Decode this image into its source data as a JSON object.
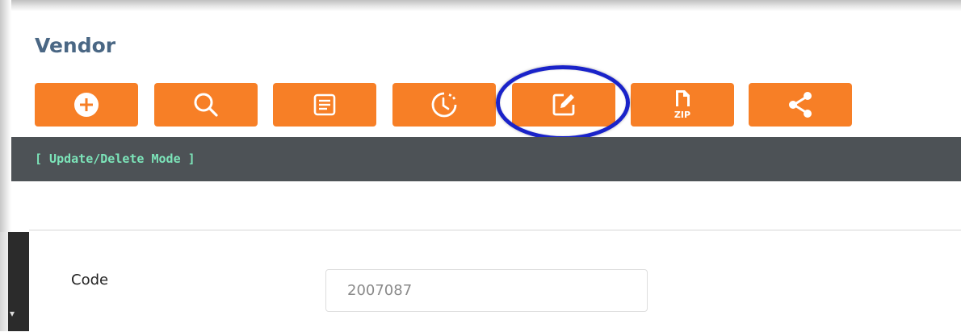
{
  "page": {
    "title": "Vendor",
    "mode_label": "[ Update/Delete Mode ]"
  },
  "toolbar": {
    "accent_color": "#f77f26",
    "highlight_color": "#1a23c9",
    "buttons": [
      {
        "icon": "add-icon"
      },
      {
        "icon": "search-icon"
      },
      {
        "icon": "list-icon"
      },
      {
        "icon": "history-icon"
      },
      {
        "icon": "edit-icon",
        "highlighted": true
      },
      {
        "icon": "zip-file-icon",
        "label": "ZIP"
      },
      {
        "icon": "share-icon"
      }
    ]
  },
  "form": {
    "code_label": "Code",
    "code_value": "2007087"
  }
}
